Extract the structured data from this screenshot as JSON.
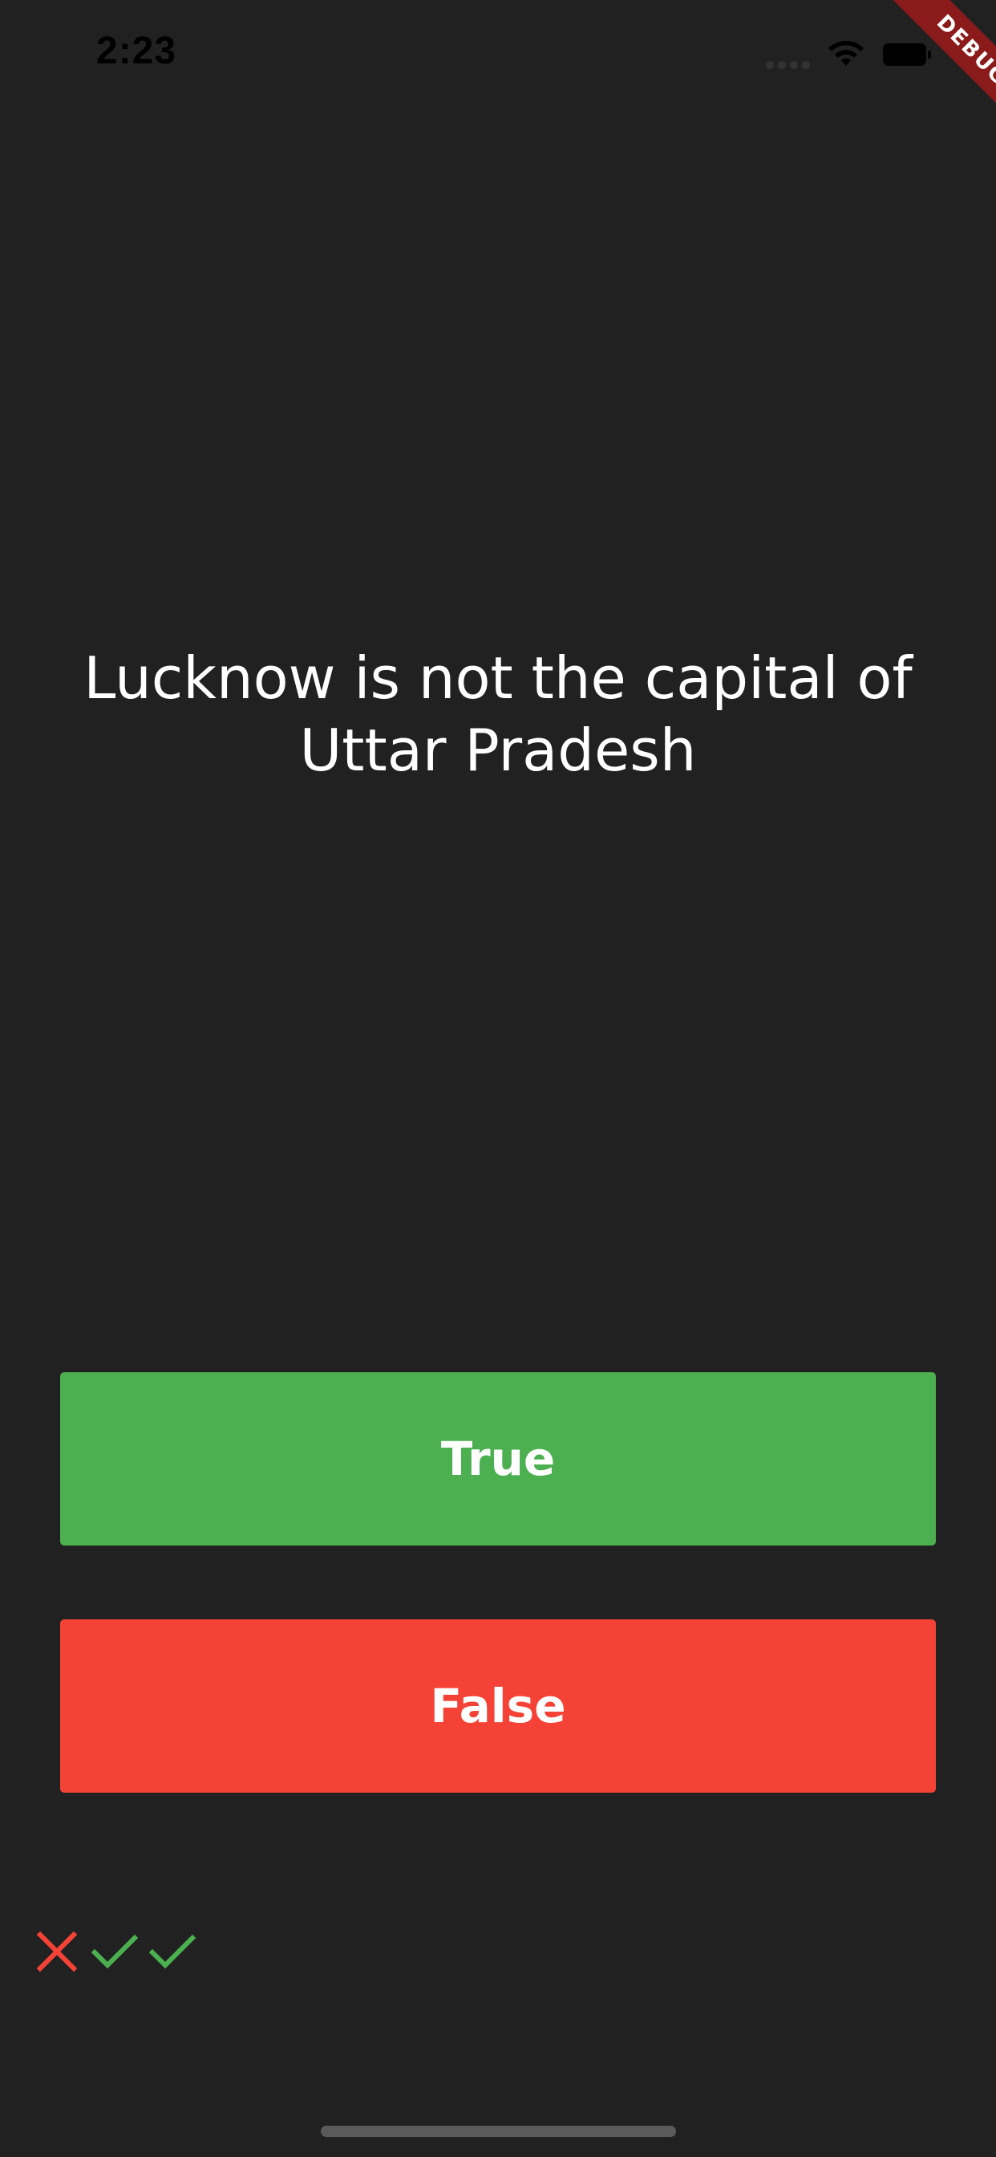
{
  "status_bar": {
    "time": "2:23",
    "signal_icon": "cellular-signal-icon",
    "wifi_icon": "wifi-icon",
    "battery_icon": "battery-icon"
  },
  "debug_banner": {
    "label": "DEBUG",
    "color": "#8b1a1a"
  },
  "quiz": {
    "question": "Lucknow is not the capital of Uttar Pradesh"
  },
  "buttons": {
    "true_label": "True",
    "true_color": "#4caf50",
    "false_label": "False",
    "false_color": "#f44336"
  },
  "score_keeper": {
    "results": [
      {
        "result": "wrong",
        "icon": "close-icon",
        "color": "#f44336"
      },
      {
        "result": "correct",
        "icon": "check-icon",
        "color": "#4caf50"
      },
      {
        "result": "correct",
        "icon": "check-icon",
        "color": "#4caf50"
      }
    ]
  },
  "theme": {
    "background": "#212121"
  }
}
